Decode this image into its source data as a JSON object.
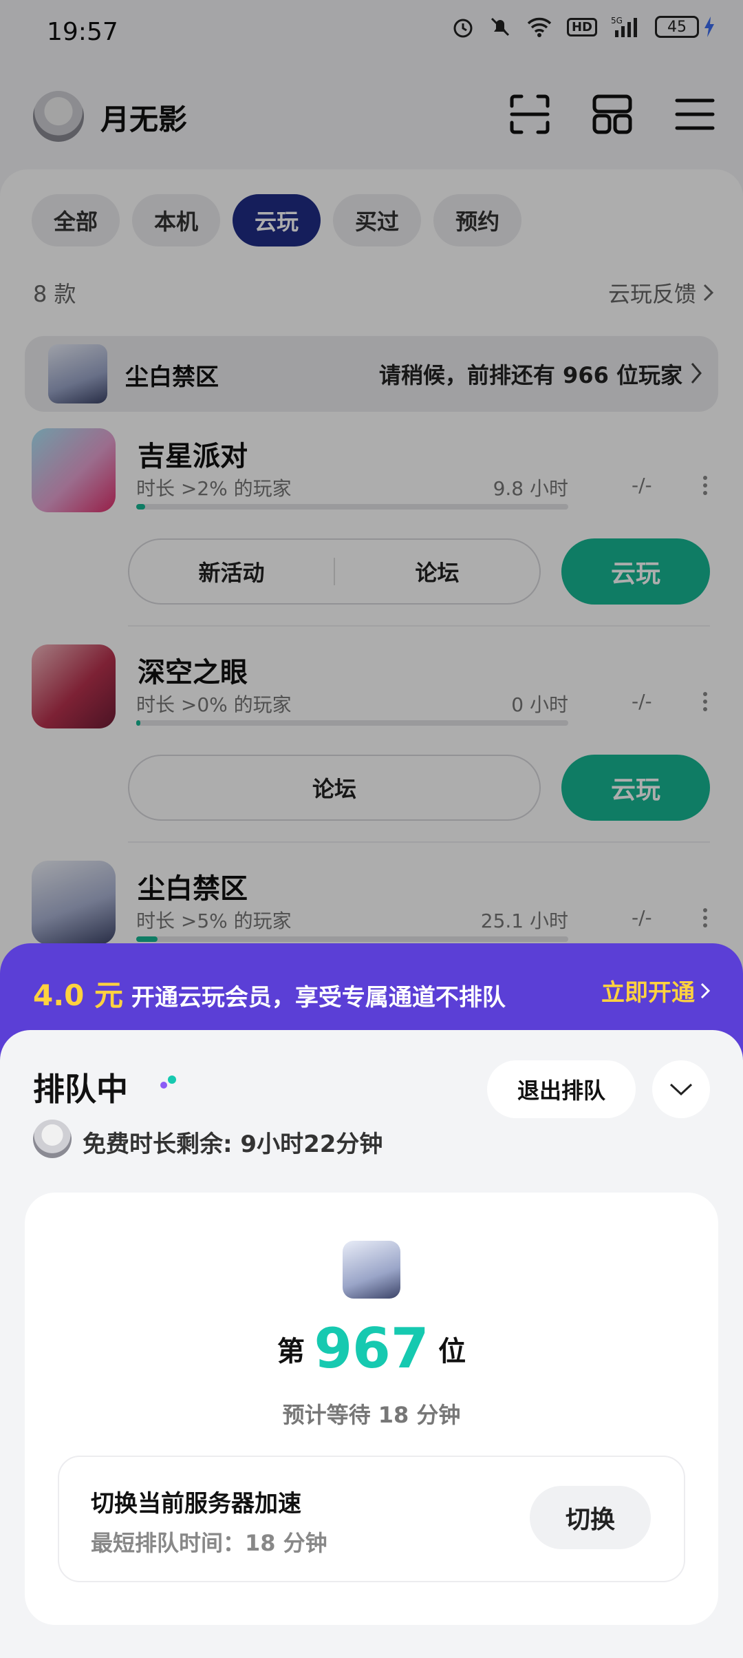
{
  "status_bar": {
    "time": "19:57",
    "hd": "HD",
    "network": "5G",
    "battery": "45"
  },
  "header": {
    "username": "月无影"
  },
  "tabs": [
    {
      "label": "全部",
      "active": false
    },
    {
      "label": "本机",
      "active": false
    },
    {
      "label": "云玩",
      "active": true
    },
    {
      "label": "买过",
      "active": false
    },
    {
      "label": "预约",
      "active": false
    }
  ],
  "list_header": {
    "count": "8 款",
    "feedback": "云玩反馈"
  },
  "queue_banner": {
    "title": "尘白禁区",
    "message": "请稍候，前排还有 966 位玩家"
  },
  "games": [
    {
      "title": "吉星派对",
      "subtitle": "时长 >2% 的玩家",
      "hours": "9.8 小时",
      "rating": "-/-",
      "progress": 0.02,
      "actions": [
        "新活动",
        "论坛"
      ],
      "cloud": "云玩",
      "icon": "game-icon-jixing"
    },
    {
      "title": "深空之眼",
      "subtitle": "时长 >0% 的玩家",
      "hours": "0 小时",
      "rating": "-/-",
      "progress": 0.0,
      "actions": [
        "论坛"
      ],
      "cloud": "云玩",
      "icon": "game-icon-shenkong"
    },
    {
      "title": "尘白禁区",
      "subtitle": "时长 >5% 的玩家",
      "hours": "25.1 小时",
      "rating": "-/-",
      "progress": 0.05,
      "icon": "game-icon-chenbai"
    }
  ],
  "promo": {
    "price": "4.0 元",
    "text": "开通云玩会员，享受专属通道不排队",
    "link": "立即开通"
  },
  "queue_sheet": {
    "title": "排队中",
    "free_time": "免费时长剩余: 9小时22分钟",
    "exit_label": "退出排队",
    "rank_prefix": "第",
    "rank": "967",
    "rank_suffix": "位",
    "wait": "预计等待 18 分钟",
    "server_title": "切换当前服务器加速",
    "server_sub": "最短排队时间：18 分钟",
    "switch_label": "切换"
  },
  "colors": {
    "accent": "#17b794",
    "tab_active": "#1f2d87",
    "promo_bg": "#5b3fd6",
    "promo_highlight": "#ffd23f",
    "rank": "#16c9b0"
  }
}
